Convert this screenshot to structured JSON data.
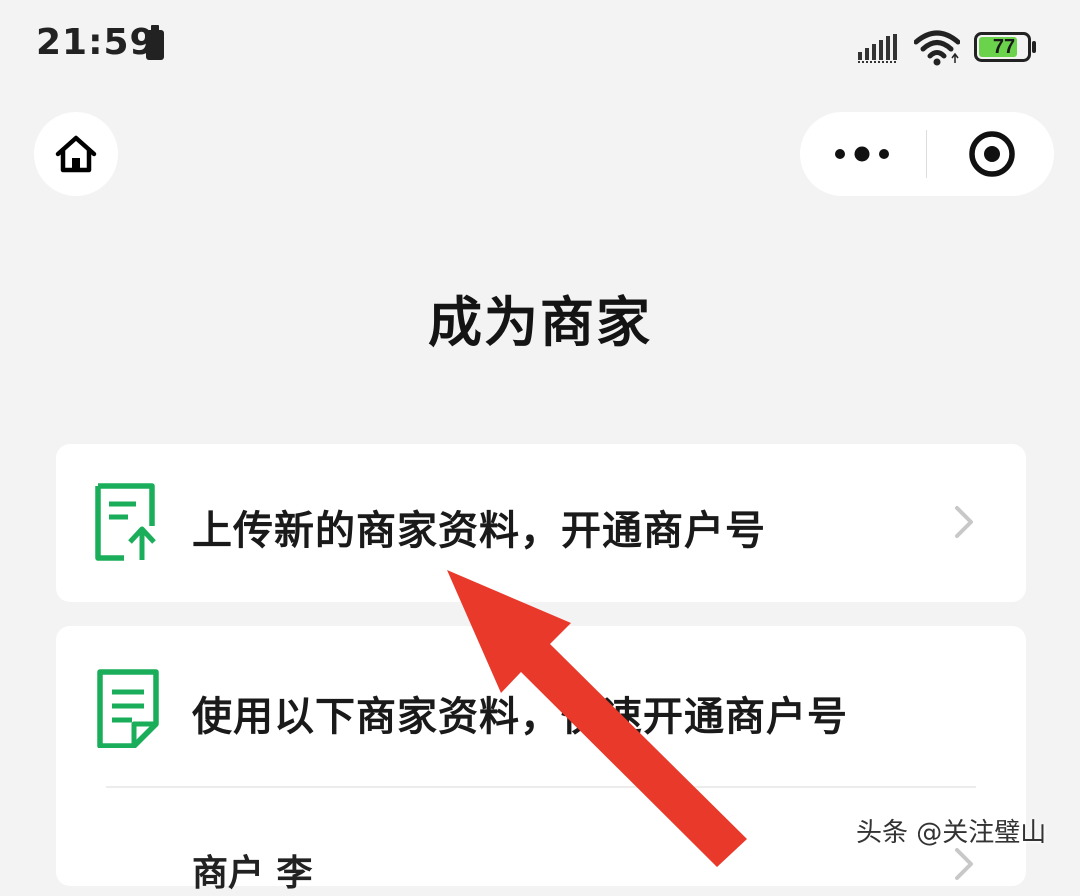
{
  "status_bar": {
    "time": "21:59",
    "battery_level": "77",
    "battery_color": "#6bd24b"
  },
  "nav": {
    "home_icon": "home-icon",
    "more_icon": "more-dots-icon",
    "close_icon": "target-close-icon"
  },
  "page": {
    "title": "成为商家"
  },
  "options": [
    {
      "label": "上传新的商家资料，开通商户号",
      "icon": "document-upload-icon"
    },
    {
      "label": "使用以下商家资料，快速开通商户号",
      "icon": "document-list-icon",
      "partial_item": "商户 李"
    }
  ],
  "annotation": {
    "arrow_color": "#e8392a"
  },
  "watermark": "头条 @关注璧山",
  "colors": {
    "accent_green": "#1aad5a",
    "background": "#f3f3f3"
  }
}
